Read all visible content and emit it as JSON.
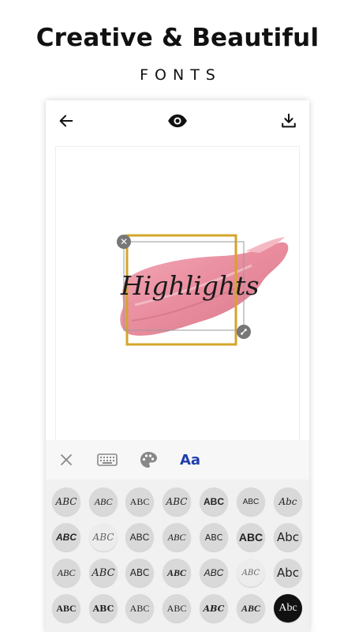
{
  "promo": {
    "headline": "Creative & Beautiful",
    "subheadline": "FONTS"
  },
  "toolbar": {
    "back_icon": "arrow-left-icon",
    "preview_icon": "eye-icon",
    "download_icon": "download-icon"
  },
  "canvas": {
    "sticker_text": "Highlights",
    "background": "pink-lipstick-swatch",
    "frame_color": "#d4a52a"
  },
  "editor_tabs": {
    "close_icon": "close-icon",
    "keyboard_icon": "keyboard-icon",
    "palette_icon": "palette-icon",
    "font_label": "Aa"
  },
  "font_samples": [
    [
      "ABC",
      "ABC",
      "ABC",
      "ABC",
      "ABC",
      "ABC",
      "Abc"
    ],
    [
      "ABC",
      "ABC",
      "ABC",
      "ABC",
      "ABC",
      "ABC",
      "Abc"
    ],
    [
      "ABC",
      "ABC",
      "ABC",
      "ABC",
      "ABC",
      "ABC",
      "Abc"
    ],
    [
      "ABC",
      "ABC",
      "ABC",
      "ABC",
      "ABC",
      "ABC",
      "Abc"
    ]
  ]
}
